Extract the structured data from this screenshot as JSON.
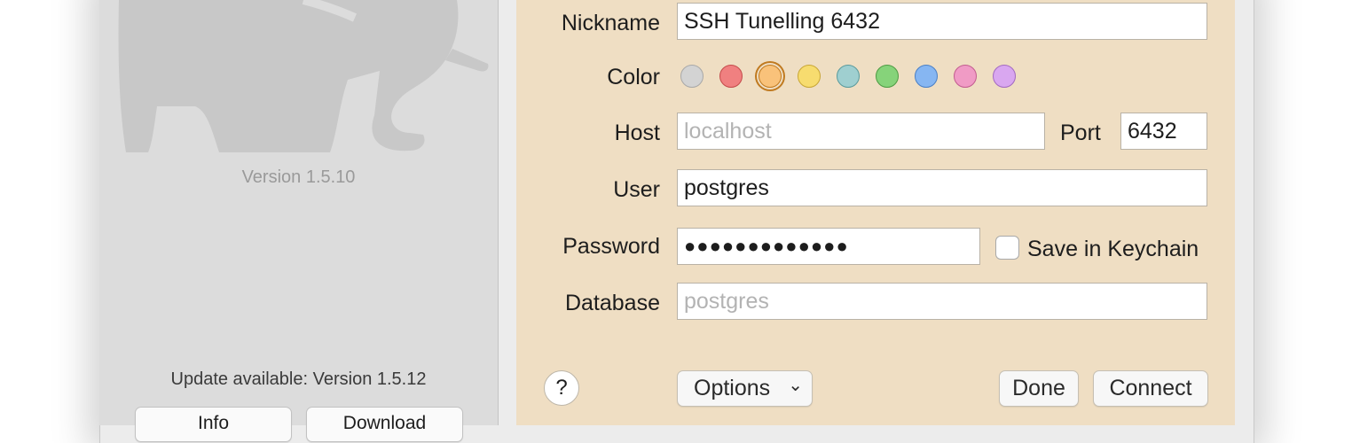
{
  "sidebar": {
    "version": "Version 1.5.10",
    "update_text": "Update available: Version 1.5.12",
    "info_label": "Info",
    "download_label": "Download"
  },
  "form": {
    "nickname_label": "Nickname",
    "nickname_value": "SSH Tunelling 6432",
    "color_label": "Color",
    "colors": [
      "#d3d3d3",
      "#f08080",
      "#f9c27a",
      "#f7dc6f",
      "#9fcfd0",
      "#86d37a",
      "#86b6f2",
      "#f09bc5",
      "#d9a7f0"
    ],
    "color_borders": [
      "#a8a8a8",
      "#c44a4a",
      "#c07a20",
      "#c8a635",
      "#5a9a9c",
      "#4e9b43",
      "#4a7fc4",
      "#c25c8f",
      "#a36ac0"
    ],
    "selected_color_index": 2,
    "host_label": "Host",
    "host_placeholder": "localhost",
    "port_label": "Port",
    "port_value": "6432",
    "user_label": "User",
    "user_value": "postgres",
    "password_label": "Password",
    "password_value": "●●●●●●●●●●●●●",
    "save_keychain_label": "Save in Keychain",
    "save_keychain_checked": false,
    "database_label": "Database",
    "database_placeholder": "postgres"
  },
  "footer": {
    "help_label": "?",
    "options_label": "Options",
    "options_chevron": "⌄",
    "done_label": "Done",
    "connect_label": "Connect"
  },
  "icons": {
    "logo": "elephant-logo-icon",
    "help": "question-icon",
    "options": "chevron-down-icon"
  }
}
